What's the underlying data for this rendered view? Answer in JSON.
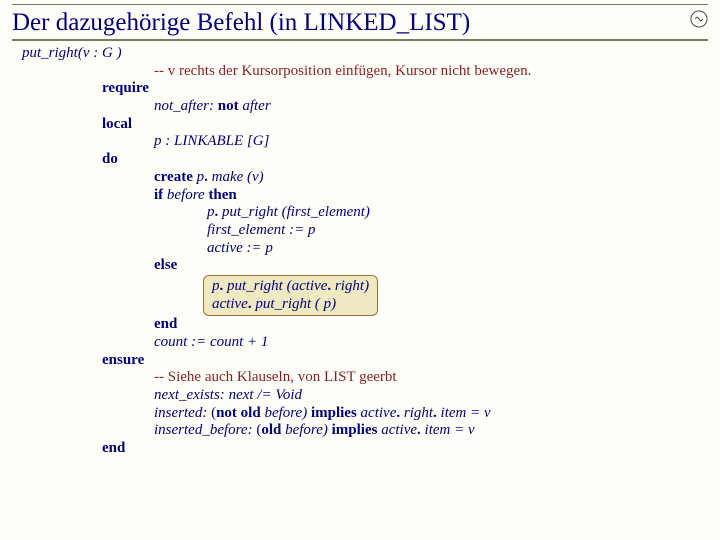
{
  "title": "Der dazugehörige Befehl (in LINKED_LIST)",
  "sig": {
    "name": "put_right",
    "args": "(v : G )"
  },
  "comment_top": "-- v rechts der Kursorposition einfügen, Kursor nicht bewegen.",
  "kw": {
    "require": "require",
    "local": "local",
    "do": "do",
    "ensure": "ensure",
    "end": "end",
    "create": "create",
    "if": "if",
    "then": "then",
    "else": "else",
    "not": "not",
    "old": "old",
    "implies": "implies"
  },
  "lines": {
    "not_after_label": "not_after:",
    "not_after_expr": "after",
    "local_decl": "p : LINKABLE [G]",
    "create_line_b": "p",
    "create_line_c": "make (v)",
    "if_cond": "before",
    "pr1_a": "p",
    "pr1_b": "put_right (first_element)",
    "fe_assign": "first_element := p",
    "active_assign": "active := p",
    "else_a1": "p",
    "else_a2": "put_right (active",
    "else_a3": "right)",
    "else_b1": "active",
    "else_b2": "put_right ( p)",
    "count": "count := count + 1",
    "ens_comment": "-- Siehe auch Klauseln, von LIST geerbt",
    "ens1_label": "next_exists:",
    "ens1_expr": "next /= Void",
    "ens2_label": "inserted:",
    "ens2_a": "before)",
    "ens2_b": "active",
    "ens2_c": "right",
    "ens2_d": "item = v",
    "ens3_label": "inserted_before:",
    "ens3_a": "before)",
    "ens3_b": "active",
    "ens3_c": "item = v"
  }
}
